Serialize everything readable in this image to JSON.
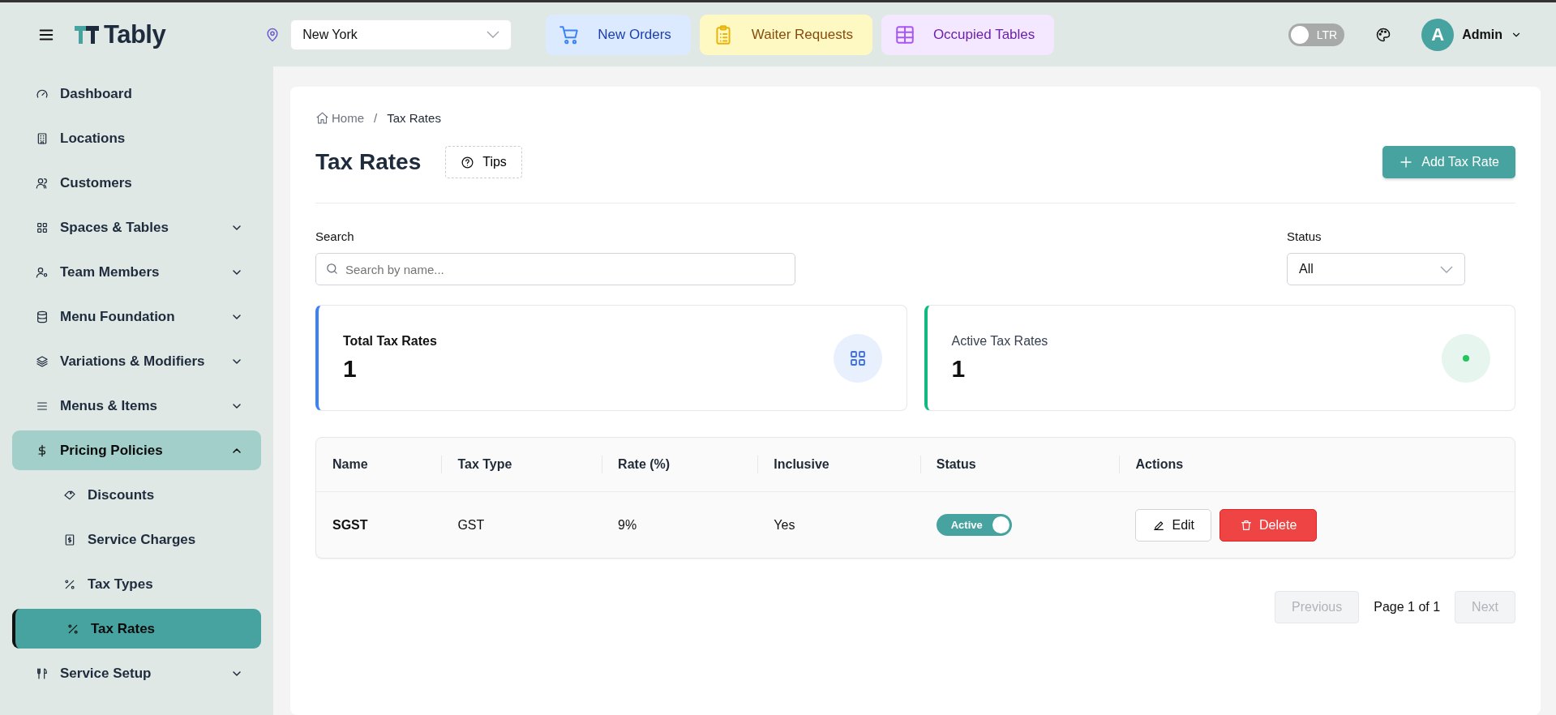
{
  "logo": "Tably",
  "header": {
    "location": "New York",
    "quick_actions": [
      {
        "label": "New Orders",
        "kind": "orders"
      },
      {
        "label": "Waiter Requests",
        "kind": "requests"
      },
      {
        "label": "Occupied Tables",
        "kind": "tables"
      }
    ],
    "direction_toggle": {
      "label": "LTR",
      "on": false
    },
    "user": {
      "initial": "A",
      "name": "Admin"
    }
  },
  "sidebar": {
    "items": [
      {
        "label": "Dashboard",
        "kind": "gauge",
        "selected": false
      },
      {
        "label": "Locations",
        "kind": "building",
        "selected": false
      },
      {
        "label": "Customers",
        "kind": "users",
        "selected": false
      },
      {
        "label": "Spaces & Tables",
        "kind": "grid",
        "selected": false,
        "expanded": false
      },
      {
        "label": "Team Members",
        "kind": "user-gear",
        "selected": false,
        "expanded": false
      },
      {
        "label": "Menu Foundation",
        "kind": "database",
        "selected": false,
        "expanded": false
      },
      {
        "label": "Variations & Modifiers",
        "kind": "layers",
        "selected": false,
        "expanded": false
      },
      {
        "label": "Menus & Items",
        "kind": "list",
        "selected": false,
        "expanded": false
      },
      {
        "label": "Pricing Policies",
        "kind": "dollar",
        "selected": false,
        "expanded": true,
        "children": [
          {
            "label": "Discounts",
            "kind": "tag",
            "selected": false
          },
          {
            "label": "Service Charges",
            "kind": "receipt",
            "selected": false
          },
          {
            "label": "Tax Types",
            "kind": "percent",
            "selected": false
          },
          {
            "label": "Tax Rates",
            "kind": "percent",
            "selected": true
          }
        ]
      },
      {
        "label": "Service Setup",
        "kind": "utensils",
        "selected": false,
        "expanded": false
      }
    ]
  },
  "breadcrumb": {
    "home": "Home",
    "separator": "/",
    "current": "Tax Rates"
  },
  "title": "Tax Rates",
  "tips_button": "Tips",
  "add_button": "Add Tax Rate",
  "filters": {
    "search_label": "Search",
    "search_placeholder": "Search by name...",
    "status_label": "Status",
    "status_value": "All"
  },
  "stats": [
    {
      "label": "Total Tax Rates",
      "value": "1",
      "kind": "total"
    },
    {
      "label": "Active Tax Rates",
      "value": "1",
      "kind": "active"
    }
  ],
  "table": {
    "columns": [
      "Name",
      "Tax Type",
      "Rate (%)",
      "Inclusive",
      "Status",
      "Actions"
    ],
    "rows": [
      {
        "name": "SGST",
        "tax_type": "GST",
        "rate": "9%",
        "inclusive": "Yes",
        "status": {
          "label": "Active",
          "on": true
        },
        "actions": [
          {
            "label": "Edit",
            "kind": "edit"
          },
          {
            "label": "Delete",
            "kind": "delete"
          }
        ]
      }
    ]
  },
  "pagination": {
    "previous": {
      "label": "Previous",
      "disabled": true
    },
    "page": "Page 1 of 1",
    "next": {
      "label": "Next",
      "disabled": true
    }
  }
}
